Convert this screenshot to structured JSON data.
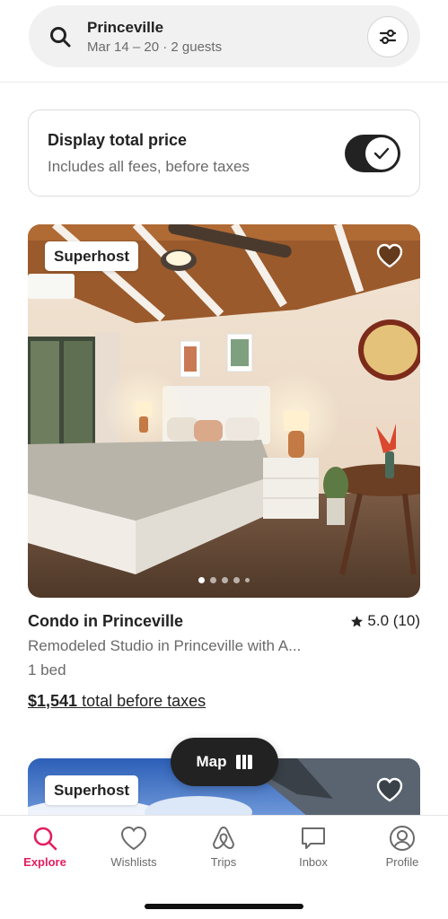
{
  "search": {
    "title": "Princeville",
    "subtitle": "Mar 14 – 20 · 2 guests"
  },
  "total_price_card": {
    "title": "Display total price",
    "subtitle": "Includes all fees, before taxes",
    "toggle_on": true
  },
  "listings": [
    {
      "badge": "Superhost",
      "title": "Condo in Princeville",
      "rating": "5.0 (10)",
      "description": "Remodeled Studio in Princeville with A...",
      "beds": "1 bed",
      "price_amount": "$1,541",
      "price_suffix": " total before taxes",
      "photo_count": 5,
      "active_photo": 1
    },
    {
      "badge": "Superhost"
    }
  ],
  "map_button": {
    "label": "Map"
  },
  "nav": [
    {
      "label": "Explore",
      "icon": "search-icon",
      "active": true
    },
    {
      "label": "Wishlists",
      "icon": "heart-icon",
      "active": false
    },
    {
      "label": "Trips",
      "icon": "airbnb-logo-icon",
      "active": false
    },
    {
      "label": "Inbox",
      "icon": "message-icon",
      "active": false
    },
    {
      "label": "Profile",
      "icon": "profile-icon",
      "active": false
    }
  ],
  "colors": {
    "brand": "#e31c5f",
    "text": "#222222",
    "muted": "#6a6a6a"
  }
}
